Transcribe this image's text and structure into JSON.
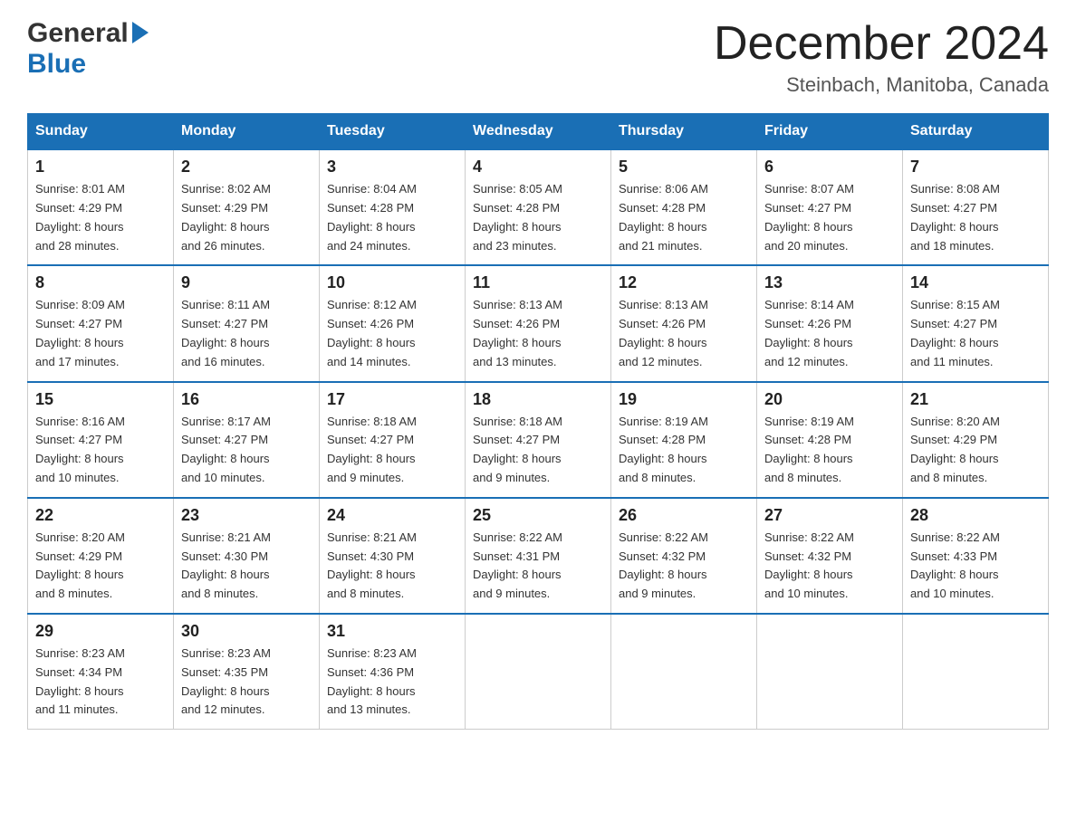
{
  "header": {
    "logo_general": "General",
    "logo_blue": "Blue",
    "month_year": "December 2024",
    "location": "Steinbach, Manitoba, Canada"
  },
  "weekdays": [
    "Sunday",
    "Monday",
    "Tuesday",
    "Wednesday",
    "Thursday",
    "Friday",
    "Saturday"
  ],
  "weeks": [
    [
      {
        "day": "1",
        "sunrise": "8:01 AM",
        "sunset": "4:29 PM",
        "daylight": "8 hours and 28 minutes."
      },
      {
        "day": "2",
        "sunrise": "8:02 AM",
        "sunset": "4:29 PM",
        "daylight": "8 hours and 26 minutes."
      },
      {
        "day": "3",
        "sunrise": "8:04 AM",
        "sunset": "4:28 PM",
        "daylight": "8 hours and 24 minutes."
      },
      {
        "day": "4",
        "sunrise": "8:05 AM",
        "sunset": "4:28 PM",
        "daylight": "8 hours and 23 minutes."
      },
      {
        "day": "5",
        "sunrise": "8:06 AM",
        "sunset": "4:28 PM",
        "daylight": "8 hours and 21 minutes."
      },
      {
        "day": "6",
        "sunrise": "8:07 AM",
        "sunset": "4:27 PM",
        "daylight": "8 hours and 20 minutes."
      },
      {
        "day": "7",
        "sunrise": "8:08 AM",
        "sunset": "4:27 PM",
        "daylight": "8 hours and 18 minutes."
      }
    ],
    [
      {
        "day": "8",
        "sunrise": "8:09 AM",
        "sunset": "4:27 PM",
        "daylight": "8 hours and 17 minutes."
      },
      {
        "day": "9",
        "sunrise": "8:11 AM",
        "sunset": "4:27 PM",
        "daylight": "8 hours and 16 minutes."
      },
      {
        "day": "10",
        "sunrise": "8:12 AM",
        "sunset": "4:26 PM",
        "daylight": "8 hours and 14 minutes."
      },
      {
        "day": "11",
        "sunrise": "8:13 AM",
        "sunset": "4:26 PM",
        "daylight": "8 hours and 13 minutes."
      },
      {
        "day": "12",
        "sunrise": "8:13 AM",
        "sunset": "4:26 PM",
        "daylight": "8 hours and 12 minutes."
      },
      {
        "day": "13",
        "sunrise": "8:14 AM",
        "sunset": "4:26 PM",
        "daylight": "8 hours and 12 minutes."
      },
      {
        "day": "14",
        "sunrise": "8:15 AM",
        "sunset": "4:27 PM",
        "daylight": "8 hours and 11 minutes."
      }
    ],
    [
      {
        "day": "15",
        "sunrise": "8:16 AM",
        "sunset": "4:27 PM",
        "daylight": "8 hours and 10 minutes."
      },
      {
        "day": "16",
        "sunrise": "8:17 AM",
        "sunset": "4:27 PM",
        "daylight": "8 hours and 10 minutes."
      },
      {
        "day": "17",
        "sunrise": "8:18 AM",
        "sunset": "4:27 PM",
        "daylight": "8 hours and 9 minutes."
      },
      {
        "day": "18",
        "sunrise": "8:18 AM",
        "sunset": "4:27 PM",
        "daylight": "8 hours and 9 minutes."
      },
      {
        "day": "19",
        "sunrise": "8:19 AM",
        "sunset": "4:28 PM",
        "daylight": "8 hours and 8 minutes."
      },
      {
        "day": "20",
        "sunrise": "8:19 AM",
        "sunset": "4:28 PM",
        "daylight": "8 hours and 8 minutes."
      },
      {
        "day": "21",
        "sunrise": "8:20 AM",
        "sunset": "4:29 PM",
        "daylight": "8 hours and 8 minutes."
      }
    ],
    [
      {
        "day": "22",
        "sunrise": "8:20 AM",
        "sunset": "4:29 PM",
        "daylight": "8 hours and 8 minutes."
      },
      {
        "day": "23",
        "sunrise": "8:21 AM",
        "sunset": "4:30 PM",
        "daylight": "8 hours and 8 minutes."
      },
      {
        "day": "24",
        "sunrise": "8:21 AM",
        "sunset": "4:30 PM",
        "daylight": "8 hours and 8 minutes."
      },
      {
        "day": "25",
        "sunrise": "8:22 AM",
        "sunset": "4:31 PM",
        "daylight": "8 hours and 9 minutes."
      },
      {
        "day": "26",
        "sunrise": "8:22 AM",
        "sunset": "4:32 PM",
        "daylight": "8 hours and 9 minutes."
      },
      {
        "day": "27",
        "sunrise": "8:22 AM",
        "sunset": "4:32 PM",
        "daylight": "8 hours and 10 minutes."
      },
      {
        "day": "28",
        "sunrise": "8:22 AM",
        "sunset": "4:33 PM",
        "daylight": "8 hours and 10 minutes."
      }
    ],
    [
      {
        "day": "29",
        "sunrise": "8:23 AM",
        "sunset": "4:34 PM",
        "daylight": "8 hours and 11 minutes."
      },
      {
        "day": "30",
        "sunrise": "8:23 AM",
        "sunset": "4:35 PM",
        "daylight": "8 hours and 12 minutes."
      },
      {
        "day": "31",
        "sunrise": "8:23 AM",
        "sunset": "4:36 PM",
        "daylight": "8 hours and 13 minutes."
      },
      null,
      null,
      null,
      null
    ]
  ],
  "labels": {
    "sunrise": "Sunrise:",
    "sunset": "Sunset:",
    "daylight": "Daylight:"
  }
}
